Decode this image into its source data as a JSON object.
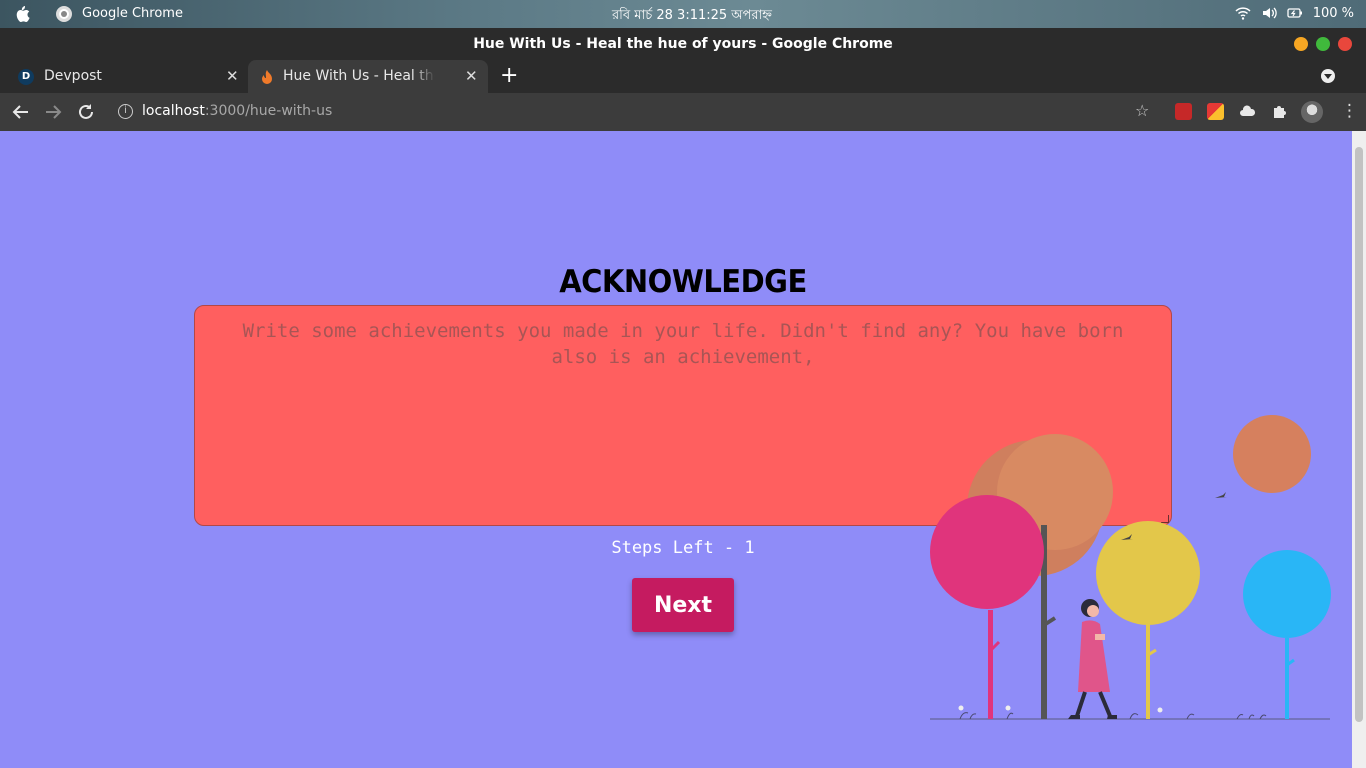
{
  "os": {
    "app_name": "Google Chrome",
    "clock": "রবি মার্চ 28   3:11:25 অপরাহ্ন",
    "battery": "100 %"
  },
  "window": {
    "title": "Hue With Us - Heal the hue of yours - Google Chrome"
  },
  "tabs": [
    {
      "label": "Devpost",
      "favicon": "D"
    },
    {
      "label": "Hue With Us - Heal the hue of yours"
    }
  ],
  "toolbar": {
    "url_host": "localhost",
    "url_rest": ":3000/hue-with-us"
  },
  "page": {
    "heading": "ACKNOWLEDGE",
    "textarea_placeholder": "Write some achievements you made in your life. Didn't find any? You have born also is an achievement,",
    "textarea_value": "",
    "steps_left": "Steps Left - 1",
    "next_label": "Next"
  },
  "colors": {
    "background": "#8f8cf8",
    "textarea": "#ff5f5f",
    "button": "#c51b60"
  },
  "icons": {
    "back": "back-arrow-icon",
    "forward": "forward-arrow-icon",
    "reload": "reload-icon",
    "info": "info-icon",
    "star": "bookmark-star-icon",
    "extensions": "puzzle-icon",
    "menu": "three-dots-menu-icon"
  }
}
